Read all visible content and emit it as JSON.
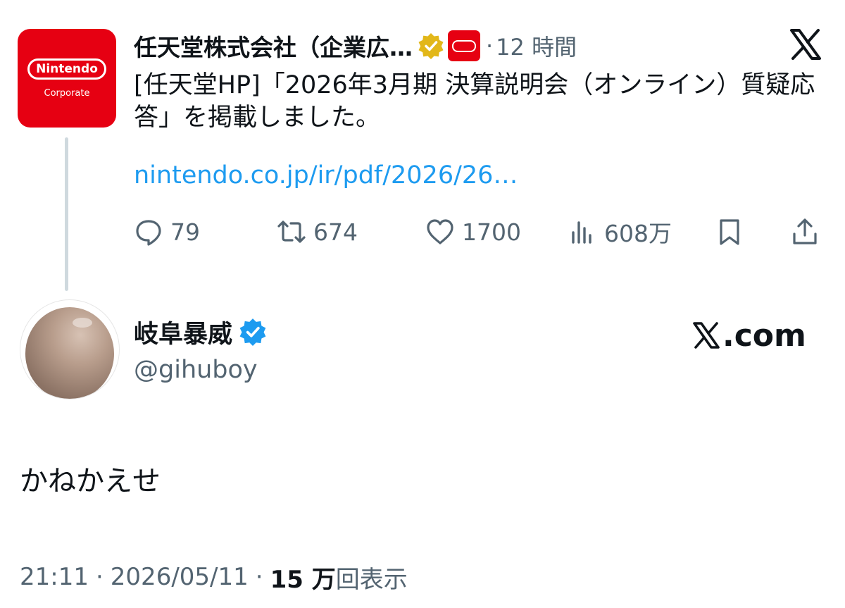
{
  "quoted_tweet": {
    "account": {
      "display_name": "任天堂株式会社（企業広…",
      "avatar_logo_text": "Nintendo",
      "avatar_sub_text": "Corporate",
      "verified_badge": "gold-check-badge",
      "affiliate_badge": "nintendo-affiliate-badge"
    },
    "separator": "·",
    "time": "12 時間",
    "text": "[任天堂HP]「2026年3月期 決算説明会（オンライン）質疑応答」を掲載しました。",
    "link": "nintendo.co.jp/ir/pdf/2026/26…",
    "metrics": {
      "replies": "79",
      "retweets": "674",
      "likes": "1700",
      "views": "608万"
    }
  },
  "main_tweet": {
    "display_name": "岐阜暴威",
    "handle": "@gihuboy",
    "source_label": ".com",
    "text": "かねかえせ",
    "time": "21:11",
    "separator": "·",
    "date": "2026/05/11",
    "views_count": "15 万",
    "views_label": "回表示"
  },
  "colors": {
    "primary_text": "#0f1419",
    "secondary_text": "#536471",
    "link": "#1d9bf0",
    "nintendo_red": "#e60012",
    "gold_badge": "#e2b719",
    "blue_badge": "#1d9bf0"
  },
  "icons": [
    "x-logo-icon",
    "reply-icon",
    "retweet-icon",
    "like-icon",
    "views-icon",
    "bookmark-icon",
    "share-icon"
  ]
}
